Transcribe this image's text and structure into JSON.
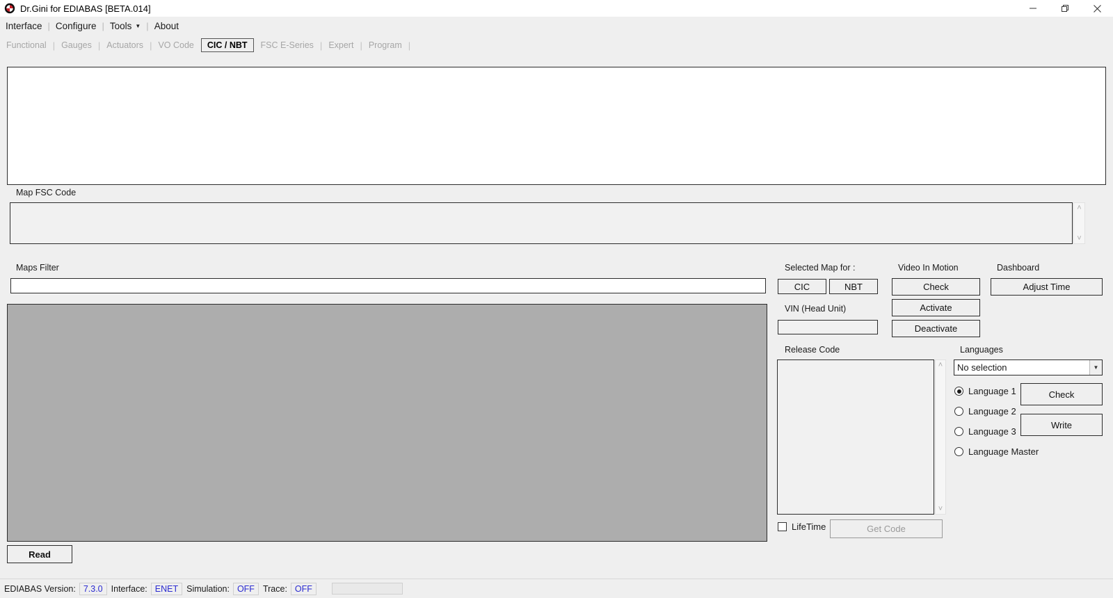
{
  "window": {
    "title": "Dr.Gini for EDIABAS [BETA.014]",
    "icon": "bmw-roundel-icon",
    "controls": {
      "minimize": "minimize",
      "maximize": "restore",
      "close": "close"
    }
  },
  "menubar": {
    "items": [
      {
        "label": "Interface",
        "has_caret": false
      },
      {
        "label": "Configure",
        "has_caret": false
      },
      {
        "label": "Tools",
        "has_caret": true
      },
      {
        "label": "About",
        "has_caret": false
      }
    ]
  },
  "tabs": [
    {
      "label": "Functional",
      "active": false
    },
    {
      "label": "Gauges",
      "active": false
    },
    {
      "label": "Actuators",
      "active": false
    },
    {
      "label": "VO Code",
      "active": false
    },
    {
      "label": "CIC / NBT",
      "active": true
    },
    {
      "label": "FSC E-Series",
      "active": false
    },
    {
      "label": "Expert",
      "active": false
    },
    {
      "label": "Program",
      "active": false
    }
  ],
  "log_panel": {
    "value": ""
  },
  "map_fsc_code": {
    "label": "Map FSC Code",
    "value": "",
    "scroll_up": "˄",
    "scroll_down": "˅"
  },
  "maps_filter": {
    "label": "Maps Filter",
    "value": "",
    "placeholder": ""
  },
  "maps_list": {
    "value": ""
  },
  "read_button": {
    "label": "Read"
  },
  "selected_map_for": {
    "label": "Selected Map for :",
    "buttons": [
      {
        "label": "CIC"
      },
      {
        "label": "NBT"
      }
    ]
  },
  "vin_head_unit": {
    "label": "VIN (Head Unit)",
    "value": "",
    "placeholder": ""
  },
  "video_in_motion": {
    "label": "Video In Motion",
    "buttons": [
      {
        "label": "Check"
      },
      {
        "label": "Activate"
      },
      {
        "label": "Deactivate"
      }
    ]
  },
  "dashboard": {
    "label": "Dashboard",
    "buttons": [
      {
        "label": "Adjust Time"
      }
    ]
  },
  "release_code": {
    "label": "Release Code",
    "value": "",
    "scroll_up": "˄",
    "scroll_down": "˅",
    "lifetime": {
      "label": "LifeTime",
      "checked": false
    },
    "get_code": {
      "label": "Get Code",
      "enabled": false
    }
  },
  "languages": {
    "label": "Languages",
    "selection": {
      "value": "No selection",
      "arrow": "▼"
    },
    "options": [
      {
        "label": "Language 1",
        "selected": true
      },
      {
        "label": "Language 2",
        "selected": false
      },
      {
        "label": "Language 3",
        "selected": false
      },
      {
        "label": "Language Master",
        "selected": false
      }
    ],
    "buttons": [
      {
        "label": "Check"
      },
      {
        "label": "Write"
      }
    ]
  },
  "statusbar": {
    "ediabas_version_label": "EDIABAS Version:",
    "ediabas_version_value": "7.3.0",
    "interface_label": "Interface:",
    "interface_value": "ENET",
    "simulation_label": "Simulation:",
    "simulation_value": "OFF",
    "trace_label": "Trace:",
    "trace_value": "OFF",
    "progress_value": ""
  }
}
